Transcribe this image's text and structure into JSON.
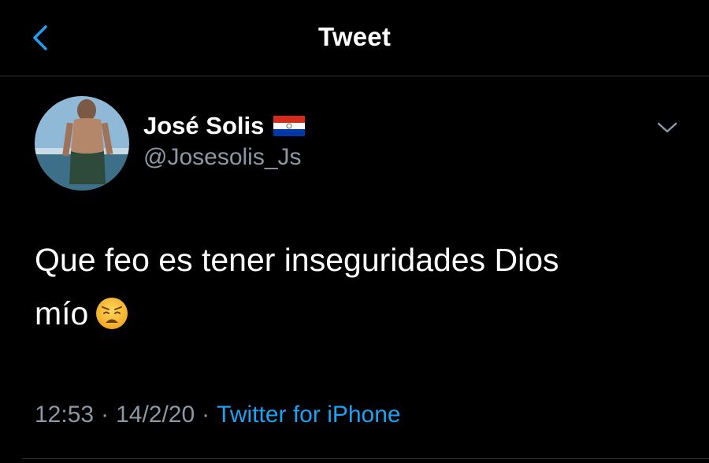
{
  "header": {
    "title": "Tweet",
    "back_icon": "chevron-left-icon"
  },
  "author": {
    "display_name": "José Solis",
    "flag_icon": "paraguay-flag-icon",
    "handle": "@Josesolis_Js"
  },
  "tweet": {
    "line1": "Que feo es tener inseguridades Dios",
    "line2": "mío",
    "emoji_icon": "weary-face-icon"
  },
  "meta": {
    "time": "12:53",
    "separator": "·",
    "date": "14/2/20",
    "source": "Twitter for iPhone"
  },
  "colors": {
    "background": "#000000",
    "accent": "#1da1f2",
    "secondary_text": "#8b98a5",
    "divider": "#2f3336"
  }
}
